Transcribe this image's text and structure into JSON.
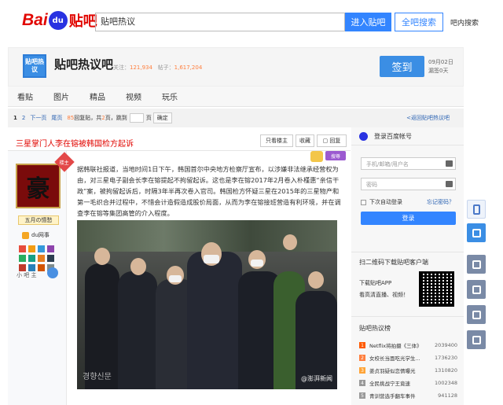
{
  "header": {
    "logo_bai": "Bai",
    "logo_paw": "du",
    "logo_tieba": "贴吧",
    "search_value": "贴吧热议",
    "enter_button": "进入贴吧",
    "all_search_button": "全吧搜索",
    "help_link": "吧内搜索"
  },
  "forum": {
    "logo_text": "贴吧热议",
    "name": "贴吧热议吧",
    "follow_label": "关注：",
    "follow_count": "121,934",
    "posts_label": "帖子：",
    "posts_count": "1,617,204",
    "sign_button": "签到",
    "sign_date": "09月02日",
    "sign_status": "漏签0天"
  },
  "nav": {
    "tabs": [
      "看贴",
      "图片",
      "精品",
      "视频",
      "玩乐"
    ]
  },
  "pager": {
    "current": "1",
    "page2": "2",
    "next": "下一页",
    "last": "尾页",
    "reply_count": "85",
    "reply_label": "回复贴，共",
    "page_total": "2",
    "page_label": "页，跳到",
    "page_suffix": "页",
    "confirm": "确定",
    "back_link": "<返回贴吧热议吧"
  },
  "post": {
    "title": "三星掌门人李在镕被韩国检方起诉",
    "only_author": "只看楼主",
    "favorite": "收藏",
    "reply": "回复",
    "louzhu_badge": "楼主",
    "avatar_glyph": "豪",
    "username": "五月の憶愁",
    "level_name": "du网事",
    "xiaoba": "小 吧 主",
    "search_badge": "搜尊",
    "body": "据韩联社报道，当地时间1日下午，韩国首尔中央地方检察厅宣布，以涉嫌非法继承经营权为由，对三星电子副会长李在镕提起不拘留起诉。这也是李在镕2017年2月卷入朴槿惠“亲信干政”案，被拘留起诉后，时隔3年半再次卷入官司。韩国检方怀疑三星在2015年的三星物产和第一毛织合并过程中，不惜会计造假造成股价局面，从而为李在镕接班营造有利环境，并在调查李在镕等集团高管的介入程度。",
    "photo_watermark_left": "경향신문",
    "photo_watermark_right": "@澎湃新闻"
  },
  "sidebar": {
    "login_title": "登录百度帐号",
    "username_placeholder": "手机/邮箱/用户名",
    "password_placeholder": "密码",
    "auto_login": "下次自动登录",
    "forgot": "忘记密码？",
    "login_button": "登录",
    "qr_title": "扫二维码下载贴吧客户端",
    "qr_line1": "下载贴吧APP",
    "qr_line2": "看高清直播、视频！",
    "hot_title": "贴吧热议榜",
    "hot_items": [
      {
        "no": "1",
        "title": "Netflix将拍摄《三体》",
        "count": "2039400",
        "color": "#ff5a00"
      },
      {
        "no": "2",
        "title": "女校长当面吃光学生...",
        "count": "1736230",
        "color": "#ff7f3e"
      },
      {
        "no": "3",
        "title": "姜贞羽疑似恋情曝光",
        "count": "1310820",
        "color": "#ffa437"
      },
      {
        "no": "4",
        "title": "全民挑战宁王竟速",
        "count": "1002348",
        "color": "#999999"
      },
      {
        "no": "5",
        "title": "青训营选手翻车事件",
        "count": "941128",
        "color": "#999999"
      }
    ]
  }
}
